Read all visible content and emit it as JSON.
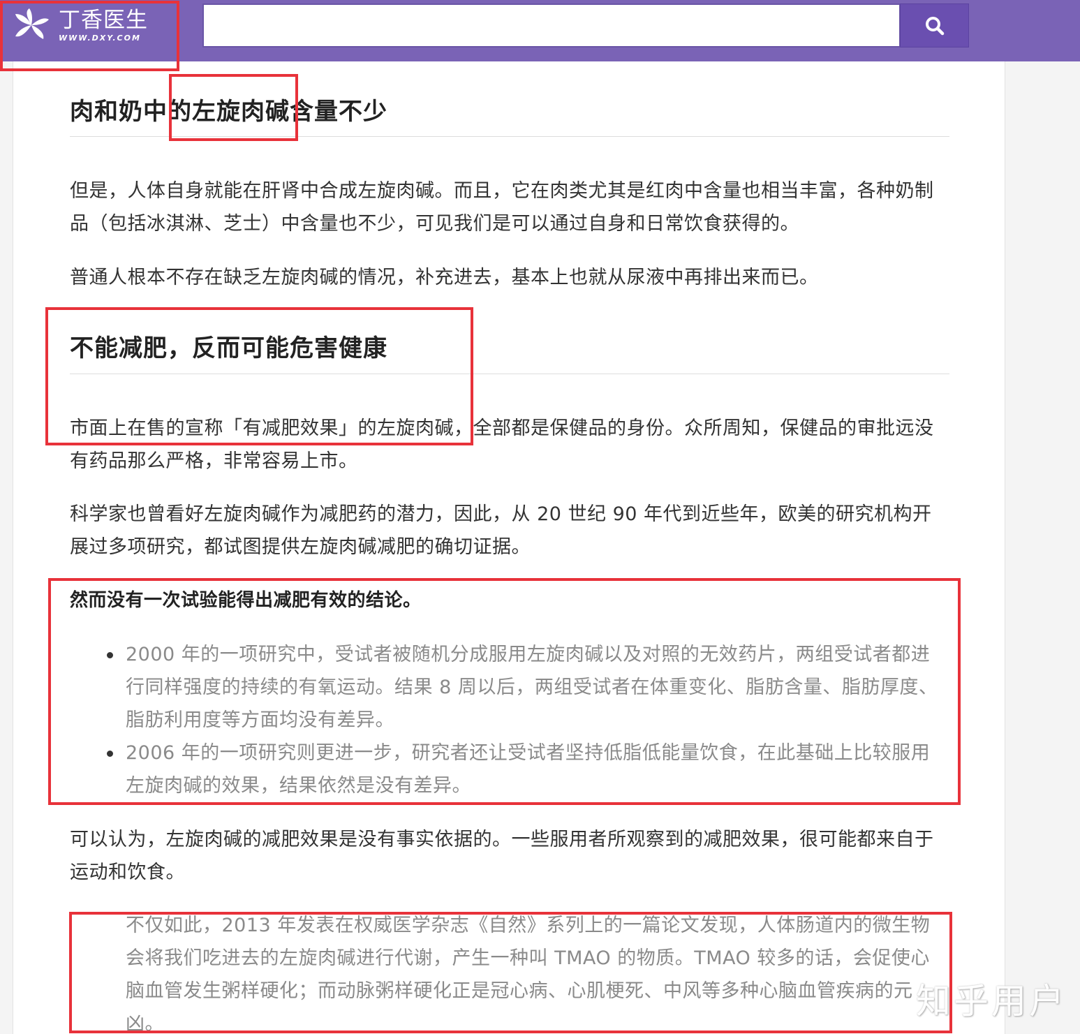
{
  "header": {
    "logo_cn": "丁香医生",
    "logo_url": "WWW.DXY.COM",
    "search_value": "",
    "search_icon": "search-icon"
  },
  "article": {
    "heading1": "肉和奶中的左旋肉碱含量不少",
    "para1": "但是，人体自身就能在肝肾中合成左旋肉碱。而且，它在肉类尤其是红肉中含量也相当丰富，各种奶制品（包括冰淇淋、芝士）中含量也不少，可见我们是可以通过自身和日常饮食获得的。",
    "para2": "普通人根本不存在缺乏左旋肉碱的情况，补充进去，基本上也就从尿液中再排出来而已。",
    "heading2": "不能减肥，反而可能危害健康",
    "para3": "市面上在售的宣称「有减肥效果」的左旋肉碱，全部都是保健品的身份。众所周知，保健品的审批远没有药品那么严格，非常容易上市。",
    "para4": "科学家也曾看好左旋肉碱作为减肥药的潜力，因此，从 20 世纪 90 年代到近些年，欧美的研究机构开展过多项研究，都试图提供左旋肉碱减肥的确切证据。",
    "para5": "然而没有一次试验能得出减肥有效的结论。",
    "list1": [
      "2000 年的一项研究中，受试者被随机分成服用左旋肉碱以及对照的无效药片，两组受试者都进行同样强度的持续的有氧运动。结果 8 周以后，两组受试者在体重变化、脂肪含量、脂肪厚度、脂肪利用度等方面均没有差异。",
      "2006 年的一项研究则更进一步，研究者还让受试者坚持低脂低能量饮食，在此基础上比较服用左旋肉碱的效果，结果依然是没有差异。"
    ],
    "para6": "可以认为，左旋肉碱的减肥效果是没有事实依据的。一些服用者所观察到的减肥效果，很可能都来自于运动和饮食。",
    "list2": [
      "不仅如此，2013 年发表在权威医学杂志《自然》系列上的一篇论文发现，人体肠道内的微生物会将我们吃进去的左旋肉碱进行代谢，产生一种叫 TMAO 的物质。TMAO 较多的话，会促使心脑血管发生粥样硬化；而动脉粥样硬化正是冠心病、心肌梗死、中风等多种心脑血管疾病的元凶。"
    ]
  },
  "watermark": "知乎用户",
  "colors": {
    "header_bg": "#7a63b6",
    "search_button": "#6a4fb0",
    "annotation_red": "#e8323a"
  }
}
